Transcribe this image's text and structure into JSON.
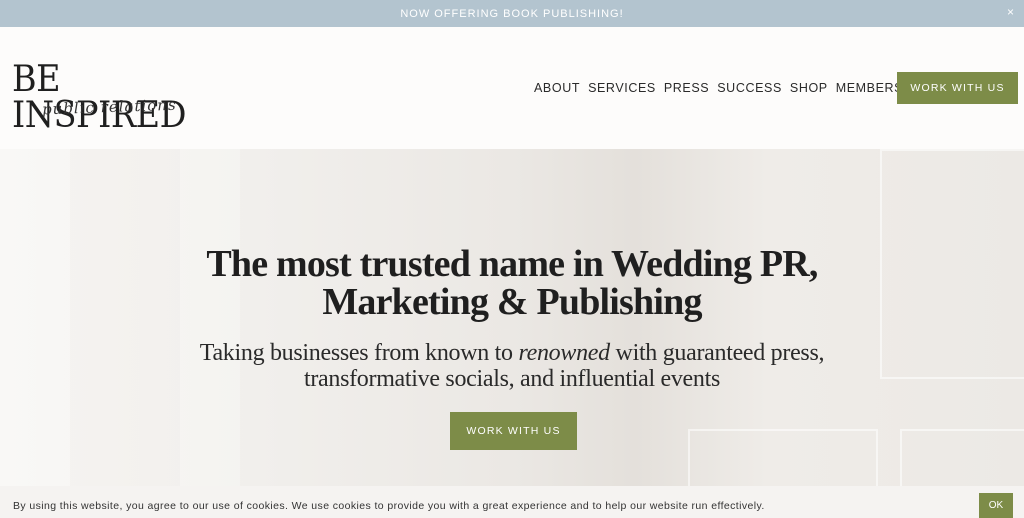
{
  "announcement": {
    "text": "NOW OFFERING BOOK PUBLISHING!",
    "close_glyph": "×"
  },
  "header": {
    "logo_main": "BE INSPIRED",
    "logo_sub": "public relations",
    "nav": [
      "ABOUT",
      "SERVICES",
      "PRESS",
      "SUCCESS",
      "SHOP",
      "MEMBERSHIP"
    ],
    "cta_label": "WORK WITH US"
  },
  "hero": {
    "headline_line1": "The most trusted name in Wedding PR,",
    "headline_line2": "Marketing & Publishing",
    "sub_line1_pre": "Taking businesses from known to ",
    "sub_line1_em": "renowned",
    "sub_line1_post": " with guaranteed press,",
    "sub_line2": "transformative socials, and influential events",
    "cta_label": "WORK WITH US"
  },
  "cookie": {
    "text": "By using this website, you agree to our use of cookies. We use cookies to provide you with a great experience and to help our website run effectively.",
    "ok_label": "OK"
  },
  "colors": {
    "accent": "#7d8c48",
    "announcement_bg": "#b3c4cf"
  }
}
